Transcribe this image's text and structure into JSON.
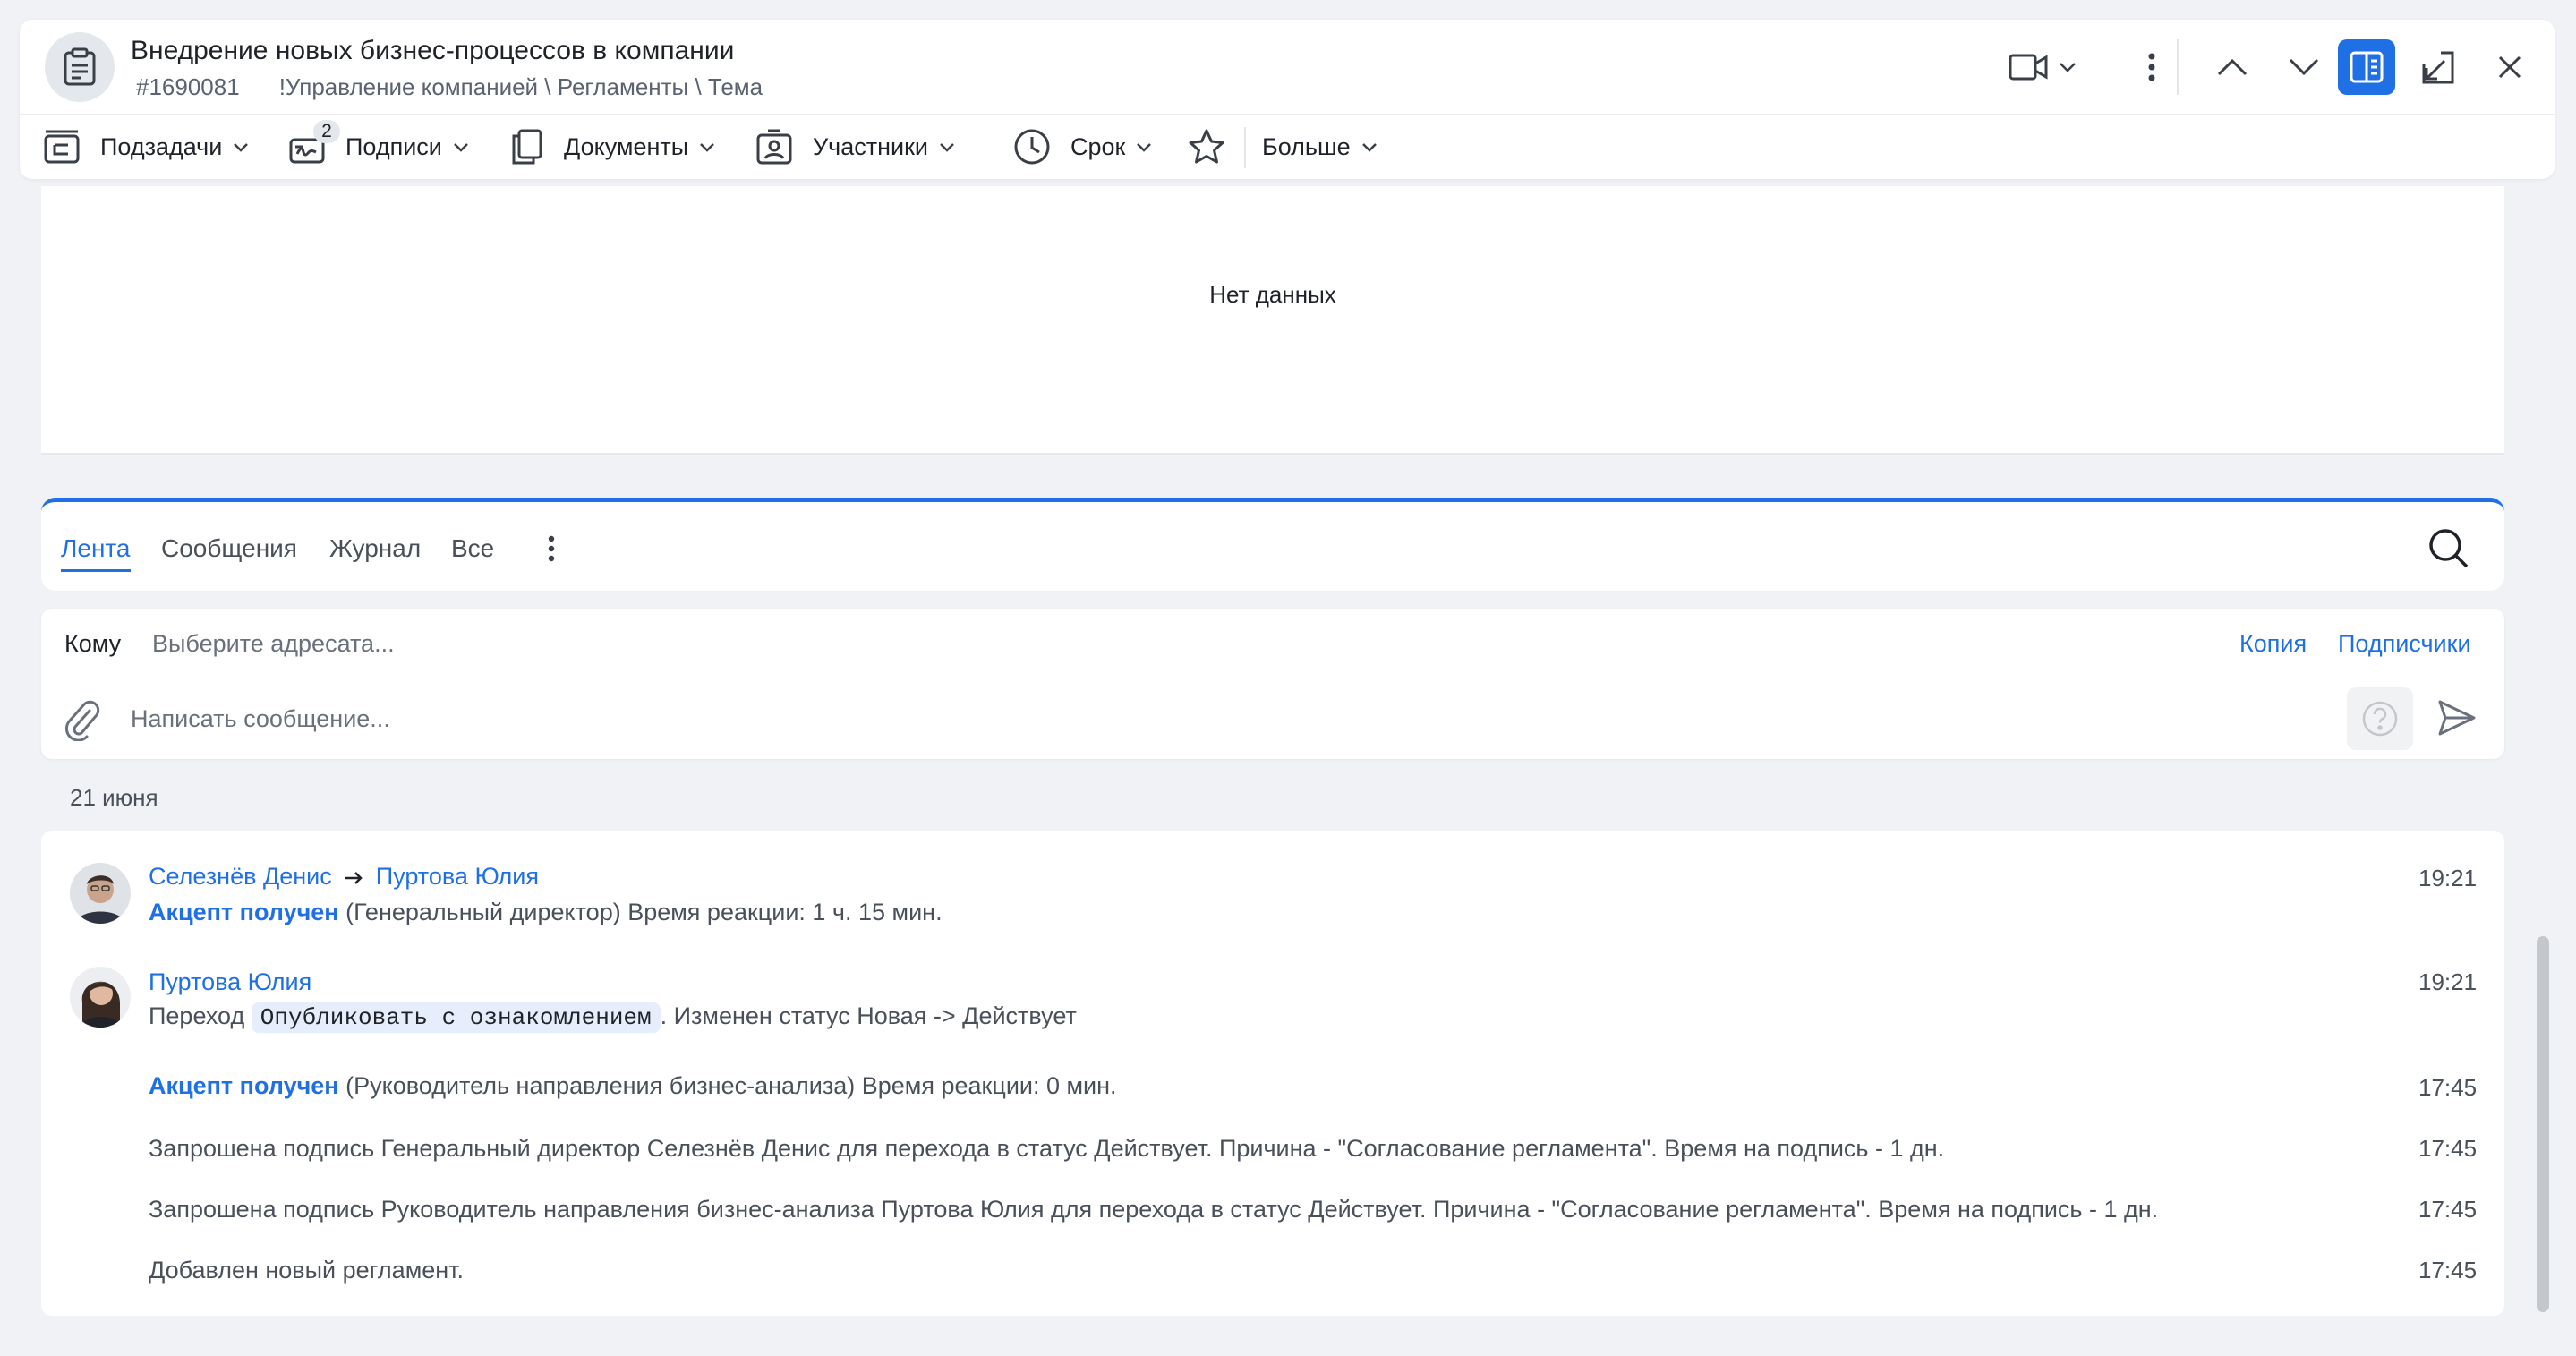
{
  "header": {
    "title": "Внедрение новых бизнес-процессов в компании",
    "id": "#1690081",
    "path": "!Управление компанией \\ Регламенты \\ Тема"
  },
  "toolbar": {
    "subtasks": "Подзадачи",
    "signatures": "Подписи",
    "signatures_badge": "2",
    "documents": "Документы",
    "participants": "Участники",
    "deadline": "Срок",
    "more": "Больше"
  },
  "empty": {
    "text": "Нет данных"
  },
  "tabs": [
    "Лента",
    "Сообщения",
    "Журнал",
    "Все"
  ],
  "compose": {
    "to_label": "Кому",
    "to_placeholder": "Выберите адресата...",
    "copy": "Копия",
    "subscribers": "Подписчики",
    "message_placeholder": "Написать сообщение..."
  },
  "date": "21 июня",
  "feed": {
    "e1": {
      "from": "Селезнёв Денис",
      "to": "Пуртова Юлия",
      "accept": "Акцепт получен",
      "text": "(Генеральный директор) Время реакции: 1 ч. 15 мин.",
      "time": "19:21"
    },
    "e2": {
      "author": "Пуртова Юлия",
      "prefix": "Переход",
      "chip": "Опубликовать с ознакомлением",
      "suffix": ". Изменен статус Новая -> Действует",
      "time": "19:21"
    },
    "e3": {
      "accept": "Акцепт получен",
      "text": "(Руководитель направления бизнес-анализа) Время реакции: 0 мин.",
      "time": "17:45"
    },
    "e4": {
      "text": "Запрошена подпись Генеральный директор Селезнёв Денис для перехода в статус Действует. Причина - \"Согласование регламента\". Время на подпись - 1 дн.",
      "time": "17:45"
    },
    "e5": {
      "text": "Запрошена подпись Руководитель направления бизнес-анализа Пуртова Юлия для перехода в статус Действует. Причина - \"Согласование регламента\". Время на подпись - 1 дн.",
      "time": "17:45"
    },
    "e6": {
      "text": "Добавлен новый регламент.",
      "time": "17:45"
    }
  }
}
